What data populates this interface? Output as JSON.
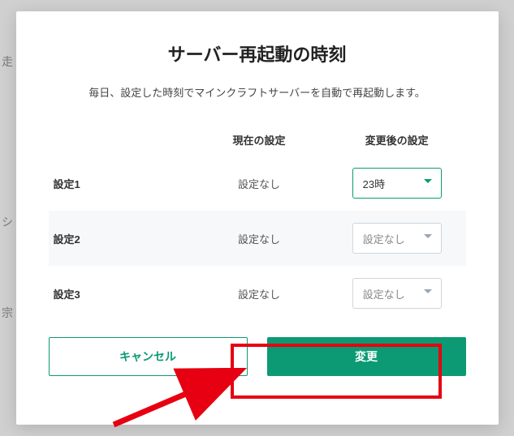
{
  "modal": {
    "title": "サーバー再起動の時刻",
    "description": "毎日、設定した時刻でマインクラフトサーバーを自動で再起動します。",
    "columns": {
      "current": "現在の設定",
      "after": "変更後の設定"
    },
    "rows": [
      {
        "label": "設定1",
        "current": "設定なし",
        "selected": "23時",
        "active": true
      },
      {
        "label": "設定2",
        "current": "設定なし",
        "selected": "設定なし",
        "active": false
      },
      {
        "label": "設定3",
        "current": "設定なし",
        "selected": "設定なし",
        "active": false
      }
    ],
    "buttons": {
      "cancel": "キャンセル",
      "submit": "変更"
    }
  },
  "annotation": {
    "highlight_color": "#e60012",
    "arrow_color": "#e60012"
  }
}
